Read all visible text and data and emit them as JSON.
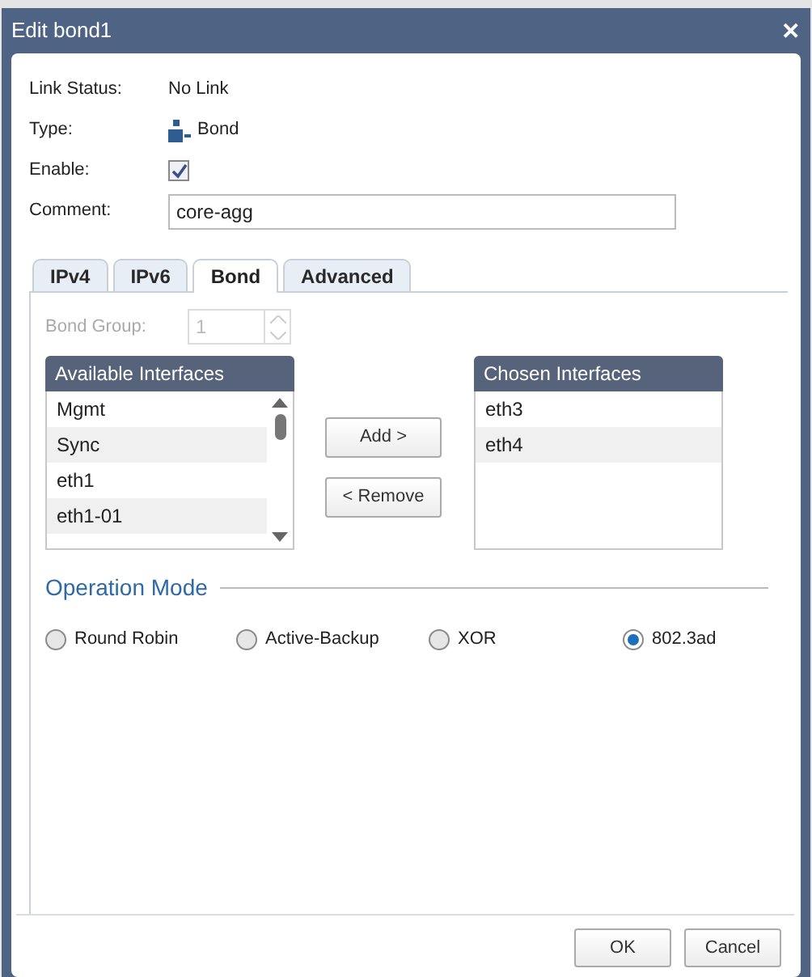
{
  "window": {
    "title": "Edit bond1",
    "close": "✕"
  },
  "fields": [
    {
      "kind": "text",
      "label": "Link Status:",
      "value": "No Link"
    },
    {
      "kind": "type",
      "label": "Type:",
      "value": "Bond"
    },
    {
      "kind": "checkbox",
      "label": "Enable:",
      "checked": true
    },
    {
      "kind": "input",
      "label": "Comment:",
      "value": "core-agg"
    }
  ],
  "tabs": [
    {
      "label": "IPv4",
      "selected": false
    },
    {
      "label": "IPv6",
      "selected": false
    },
    {
      "label": "Bond",
      "selected": true
    },
    {
      "label": "Advanced",
      "selected": false
    }
  ],
  "bond_group": {
    "label": "Bond Group:",
    "value": "1",
    "disabled": true
  },
  "available": {
    "title": "Available Interfaces",
    "rows": [
      "Mgmt",
      "Sync",
      "eth1",
      "eth1-01"
    ]
  },
  "actions": [
    "Add >",
    "< Remove"
  ],
  "chosen": {
    "title": "Chosen Interfaces",
    "rows": [
      "eth3",
      "eth4"
    ]
  },
  "operation_mode": {
    "title": "Operation Mode",
    "options": [
      {
        "label": "Round Robin",
        "selected": false
      },
      {
        "label": "Active-Backup",
        "selected": false
      },
      {
        "label": "XOR",
        "selected": false
      },
      {
        "label": "802.3ad",
        "selected": true
      }
    ]
  },
  "buttons": [
    "OK",
    "Cancel"
  ]
}
